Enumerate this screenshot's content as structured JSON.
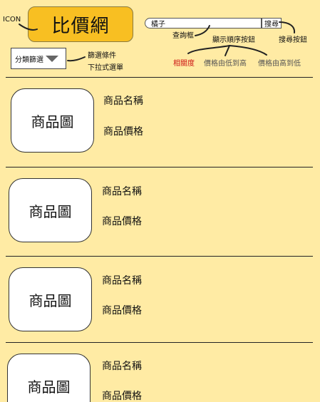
{
  "header": {
    "logo_annotation": "ICON",
    "logo_text": "比價網"
  },
  "search": {
    "value": "橘子",
    "button_label": "搜尋",
    "input_annotation": "查詢框",
    "button_annotation": "搜尋按鈕"
  },
  "filter": {
    "label": "分類篩選",
    "annotation_line1": "篩選條件",
    "annotation_line2": "下拉式選單"
  },
  "sort": {
    "annotation": "顯示順序按鈕",
    "options": [
      {
        "label": "相關度",
        "active": true
      },
      {
        "label": "價格由低到高",
        "active": false
      },
      {
        "label": "價格由高到低",
        "active": false
      }
    ]
  },
  "products": [
    {
      "image_label": "商品圖",
      "name": "商品名稱",
      "price": "商品價格"
    },
    {
      "image_label": "商品圖",
      "name": "商品名稱",
      "price": "商品價格"
    },
    {
      "image_label": "商品圖",
      "name": "商品名稱",
      "price": "商品價格"
    },
    {
      "image_label": "商品圖",
      "name": "商品名稱",
      "price": "商品價格"
    }
  ],
  "colors": {
    "background": "#FFEBA4",
    "logo_fill": "#F8BF22",
    "active_sort": "#CC1111",
    "inactive_sort": "#555555"
  }
}
